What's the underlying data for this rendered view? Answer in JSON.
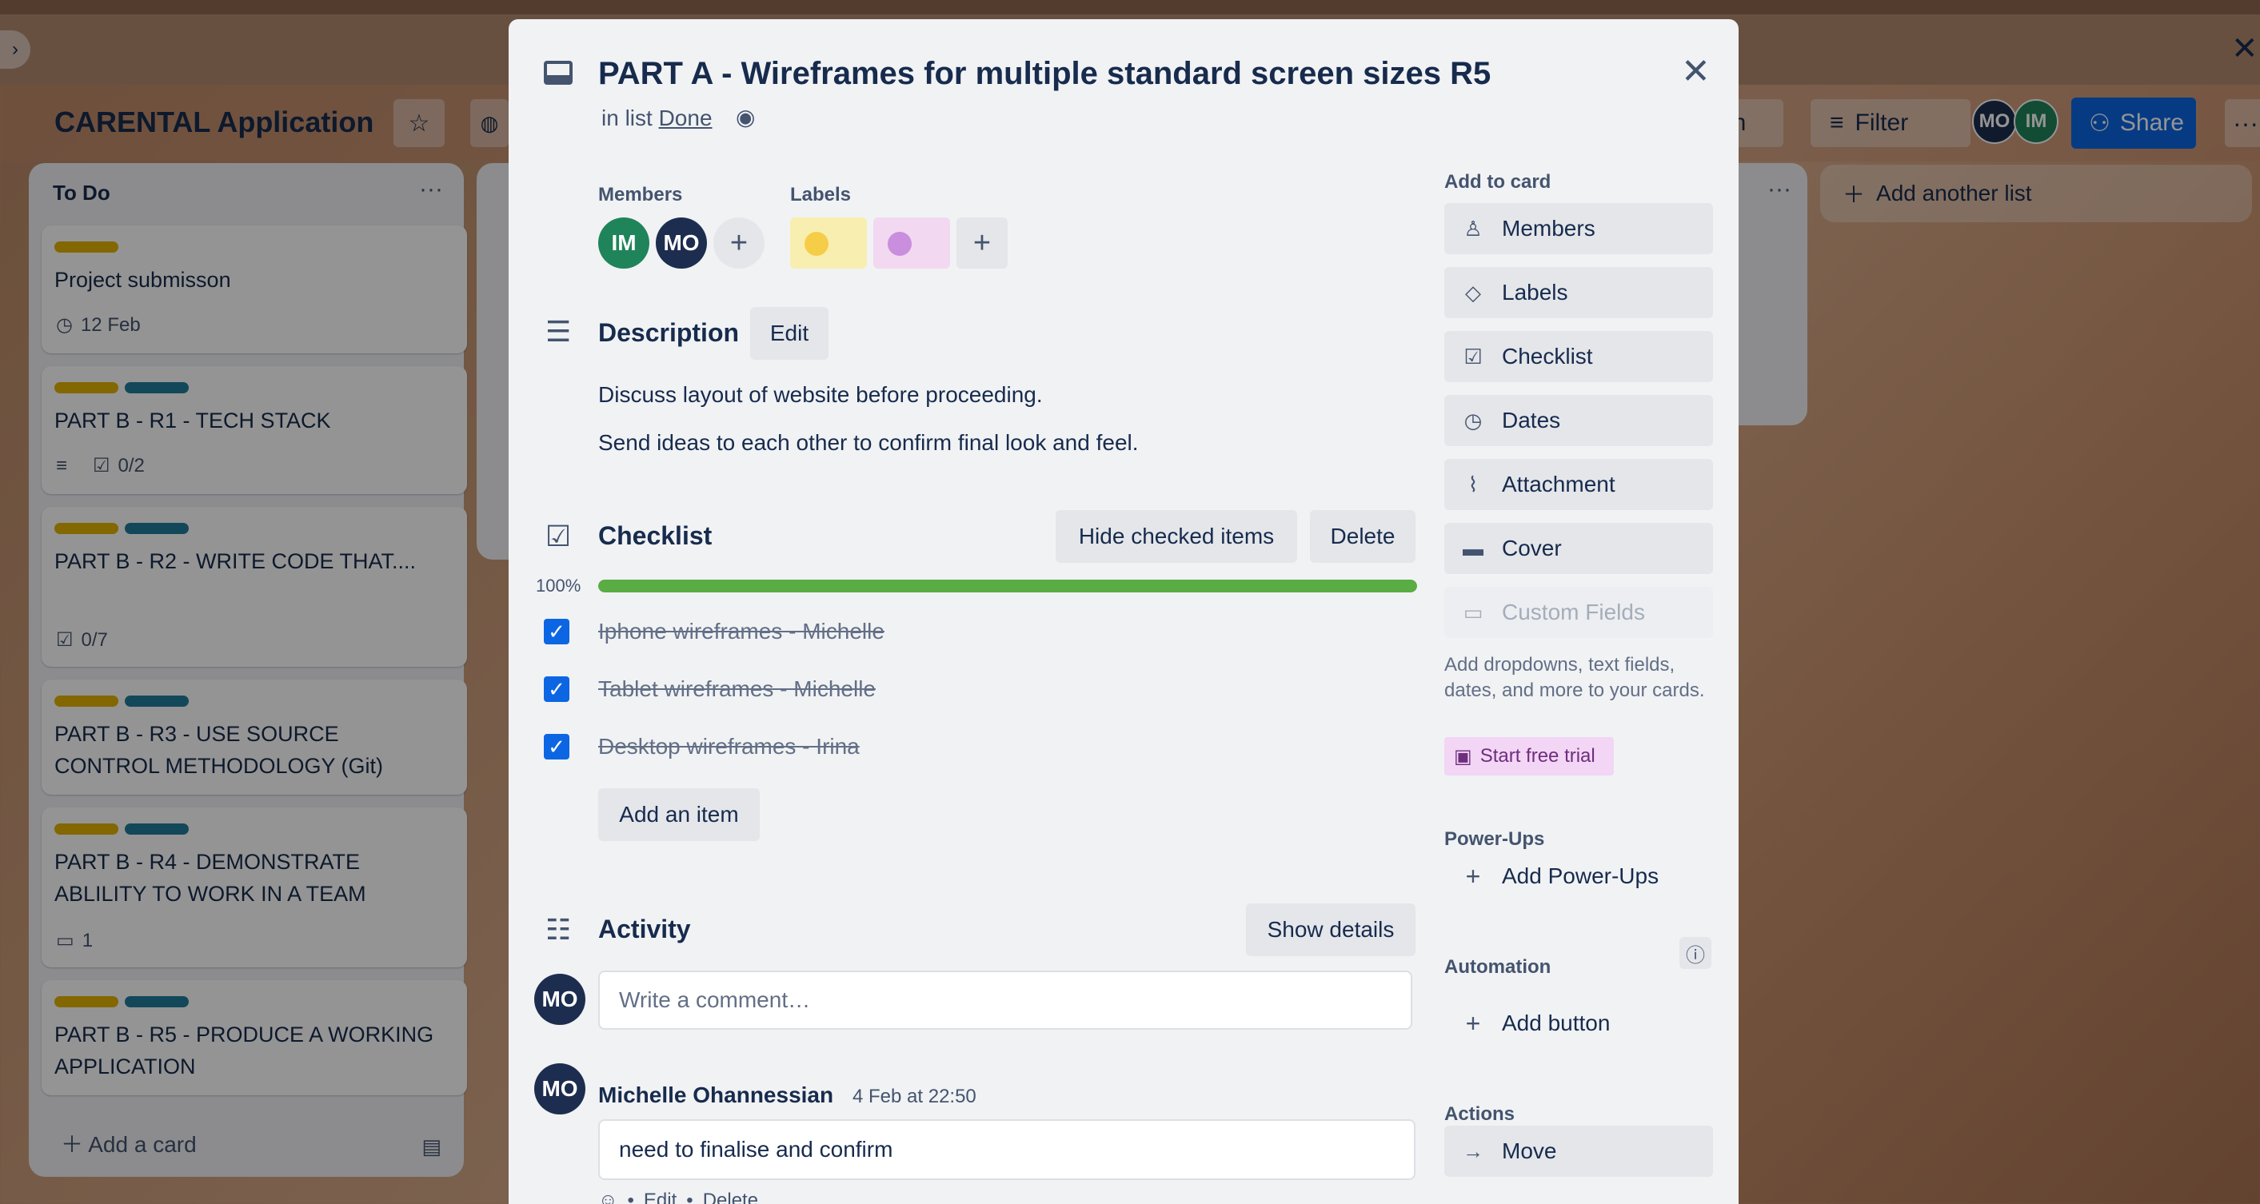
{
  "board": {
    "title": "CARENTAL Application",
    "filter_label": "Filter",
    "automation_label_partial": "on",
    "share_label": "Share",
    "header_avatars": [
      {
        "initials": "MO",
        "color": "#1d2d4f"
      },
      {
        "initials": "IM",
        "color": "#1f845a"
      }
    ],
    "add_list_label": "Add another list"
  },
  "todo_list": {
    "title": "To Do",
    "cards": [
      {
        "title": "Project submisson",
        "labels": [
          "#e2b203"
        ],
        "meta": "12 Feb",
        "meta_icon": "clock-icon"
      },
      {
        "title": "PART B - R1 - TECH STACK",
        "labels": [
          "#e2b203",
          "#227d9b"
        ],
        "meta": "0/2",
        "meta_icon": "checklist-icon",
        "has_description": true
      },
      {
        "title": "PART B - R2 - WRITE CODE THAT....",
        "labels": [
          "#e2b203",
          "#227d9b"
        ],
        "meta": "0/7",
        "meta_icon": "checklist-icon"
      },
      {
        "title": "PART B - R3 - USE SOURCE CONTROL METHODOLOGY (Git)",
        "labels": [
          "#e2b203",
          "#227d9b"
        ],
        "meta": "",
        "meta_icon": ""
      },
      {
        "title": "PART B - R4 - DEMONSTRATE ABLILITY TO WORK IN A TEAM",
        "labels": [
          "#e2b203",
          "#227d9b"
        ],
        "meta": "1",
        "meta_icon": "comment-icon"
      },
      {
        "title": "PART B - R5 - PRODUCE A WORKING APPLICATION",
        "labels": [
          "#e2b203",
          "#227d9b"
        ],
        "meta": "",
        "meta_icon": ""
      }
    ],
    "add_card_label": "Add a card"
  },
  "modal": {
    "title": "PART A - Wireframes for multiple standard screen sizes R5",
    "in_list_prefix": "in list",
    "list_name": "Done",
    "members_label": "Members",
    "labels_label": "Labels",
    "members": [
      {
        "initials": "IM",
        "color": "#1f845a"
      },
      {
        "initials": "MO",
        "color": "#1d2d4f"
      }
    ],
    "card_labels": [
      {
        "bg": "#f8eeb0",
        "dot": "#f5cd47"
      },
      {
        "bg": "#f2d8f0",
        "dot": "#c98ede"
      }
    ],
    "description": {
      "title": "Description",
      "edit_label": "Edit",
      "lines": [
        "Discuss layout of website before proceeding.",
        "Send ideas to each other to confirm final look and feel."
      ]
    },
    "checklist": {
      "title": "Checklist",
      "hide_label": "Hide checked items",
      "delete_label": "Delete",
      "progress_label": "100%",
      "progress": 1.0,
      "items": [
        {
          "text": "Iphone wireframes - Michelle",
          "checked": true
        },
        {
          "text": "Tablet wireframes - Michelle",
          "checked": true
        },
        {
          "text": "Desktop wireframes - Irina",
          "checked": true
        }
      ],
      "add_item_label": "Add an item"
    },
    "activity": {
      "title": "Activity",
      "show_details_label": "Show details",
      "comment_placeholder": "Write a comment…",
      "current_user_initials": "MO",
      "comments": [
        {
          "author": "Michelle Ohannessian",
          "initials": "MO",
          "time": "4 Feb at 22:50",
          "text": "need to finalise and confirm",
          "edit_label": "Edit",
          "delete_label": "Delete"
        }
      ]
    },
    "sidebar": {
      "add_to_card_label": "Add to card",
      "add_to_card": [
        {
          "label": "Members",
          "icon": "person-icon"
        },
        {
          "label": "Labels",
          "icon": "tag-icon"
        },
        {
          "label": "Checklist",
          "icon": "checklist-icon"
        },
        {
          "label": "Dates",
          "icon": "clock-icon"
        },
        {
          "label": "Attachment",
          "icon": "paperclip-icon"
        },
        {
          "label": "Cover",
          "icon": "cover-icon"
        },
        {
          "label": "Custom Fields",
          "icon": "custom-fields-icon",
          "disabled": true
        }
      ],
      "custom_fields_note": "Add dropdowns, text fields, dates, and more to your cards.",
      "trial_label": "Start free trial",
      "powerups_label": "Power-Ups",
      "add_powerups_label": "Add Power-Ups",
      "automation_label": "Automation",
      "add_button_label": "Add button",
      "actions_label": "Actions",
      "move_label": "Move"
    }
  }
}
